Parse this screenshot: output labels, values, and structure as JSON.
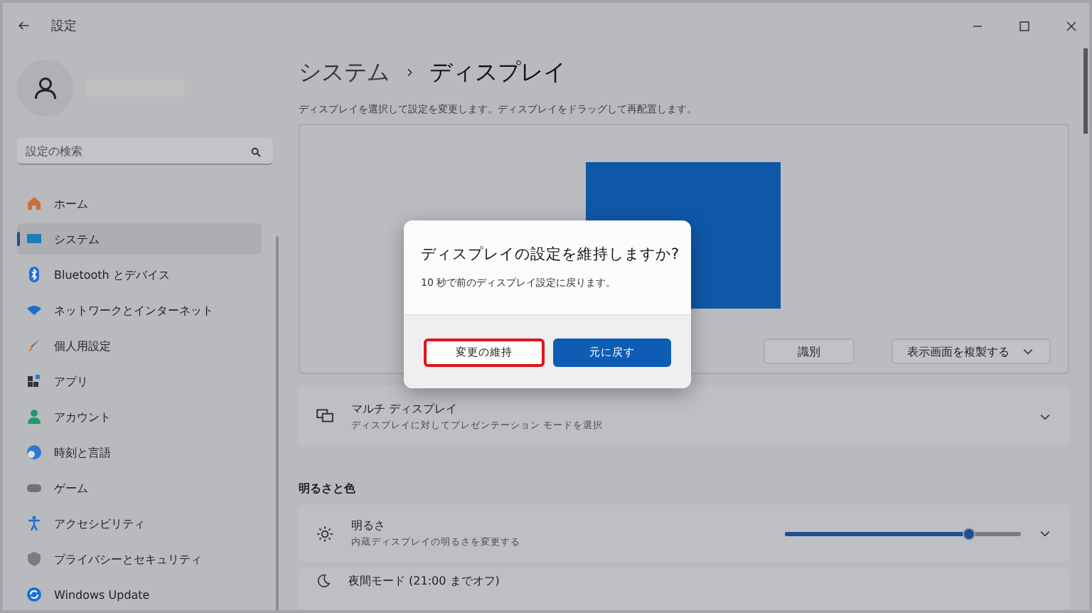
{
  "window": {
    "title": "設定"
  },
  "sidebar": {
    "search": {
      "placeholder": "設定の検索"
    },
    "items": [
      {
        "label": "ホーム",
        "selected": false
      },
      {
        "label": "システム",
        "selected": true
      },
      {
        "label": "Bluetooth とデバイス",
        "selected": false
      },
      {
        "label": "ネットワークとインターネット",
        "selected": false
      },
      {
        "label": "個人用設定",
        "selected": false
      },
      {
        "label": "アプリ",
        "selected": false
      },
      {
        "label": "アカウント",
        "selected": false
      },
      {
        "label": "時刻と言語",
        "selected": false
      },
      {
        "label": "ゲーム",
        "selected": false
      },
      {
        "label": "アクセシビリティ",
        "selected": false
      },
      {
        "label": "プライバシーとセキュリティ",
        "selected": false
      },
      {
        "label": "Windows Update",
        "selected": false
      }
    ]
  },
  "breadcrumb": [
    "システム",
    "ディスプレイ"
  ],
  "description": "ディスプレイを選択して設定を変更します。ディスプレイをドラッグして再配置します。",
  "arrangement": {
    "buttons": [
      {
        "label": "識別",
        "kind": "plain"
      },
      {
        "label": "表示画面を複製する",
        "kind": "dropdown"
      }
    ]
  },
  "multi_display": {
    "title": "マルチ ディスプレイ",
    "subtitle": "ディスプレイに対してプレゼンテーション モードを選択"
  },
  "section_heading": "明るさと色",
  "brightness": {
    "title": "明るさ",
    "subtitle": "内蔵ディスプレイの明るさを変更する",
    "level": 0.78
  },
  "night_mode": {
    "title": "夜間モード (21:00 までオフ)"
  },
  "dialog": {
    "title": "ディスプレイの設定を維持しますか?",
    "message": "10 秒で前のディスプレイ設定に戻ります。",
    "buttons": [
      {
        "label": "変更の維持",
        "kind": "secondary",
        "highlighted": true
      },
      {
        "label": "元に戻す",
        "kind": "primary",
        "highlighted": false
      }
    ]
  }
}
